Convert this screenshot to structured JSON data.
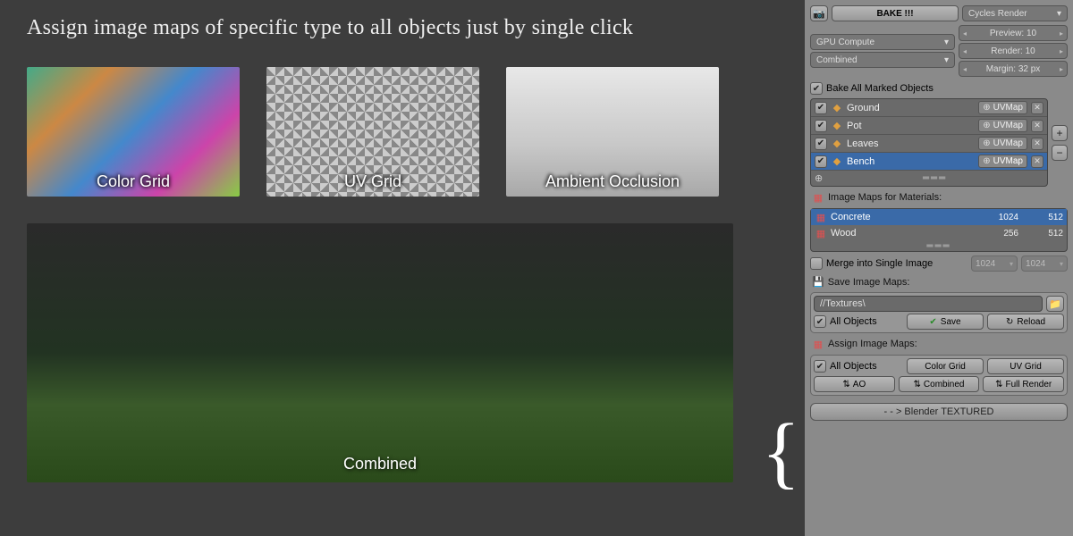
{
  "headline": "Assign image maps of specific type to all objects just by single click",
  "thumbs": [
    {
      "label": "Color Grid"
    },
    {
      "label": "UV Grid"
    },
    {
      "label": "Ambient Occlusion"
    }
  ],
  "main_label": "Combined",
  "panel": {
    "bake_btn": "BAKE !!!",
    "render_engine": "Cycles Render",
    "device": "GPU Compute",
    "pass": "Combined",
    "preview": {
      "label": "Preview:",
      "value": "10"
    },
    "render": {
      "label": "Render:",
      "value": "10"
    },
    "margin": {
      "label": "Margin:",
      "value": "32 px"
    },
    "bake_all_label": "Bake All Marked Objects",
    "objects": [
      {
        "name": "Ground",
        "uv": "UVMap",
        "checked": true,
        "selected": false
      },
      {
        "name": "Pot",
        "uv": "UVMap",
        "checked": true,
        "selected": false
      },
      {
        "name": "Leaves",
        "uv": "UVMap",
        "checked": true,
        "selected": false
      },
      {
        "name": "Bench",
        "uv": "UVMap",
        "checked": true,
        "selected": true
      }
    ],
    "image_maps_header": "Image Maps for Materials:",
    "materials": [
      {
        "name": "Concrete",
        "w": "1024",
        "h": "512",
        "selected": true
      },
      {
        "name": "Wood",
        "w": "256",
        "h": "512",
        "selected": false
      }
    ],
    "merge_label": "Merge into Single Image",
    "merge_w": "1024",
    "merge_h": "1024",
    "save_header": "Save Image Maps:",
    "save_path": "//Textures\\",
    "all_objects": "All Objects",
    "save_btn": "Save",
    "reload_btn": "Reload",
    "assign_header": "Assign Image Maps:",
    "assign": {
      "all_objects": "All Objects",
      "color_grid": "Color Grid",
      "uv_grid": "UV Grid",
      "ao": "AO",
      "combined": "Combined",
      "full_render": "Full Render"
    },
    "footer": "- - > Blender TEXTURED"
  }
}
